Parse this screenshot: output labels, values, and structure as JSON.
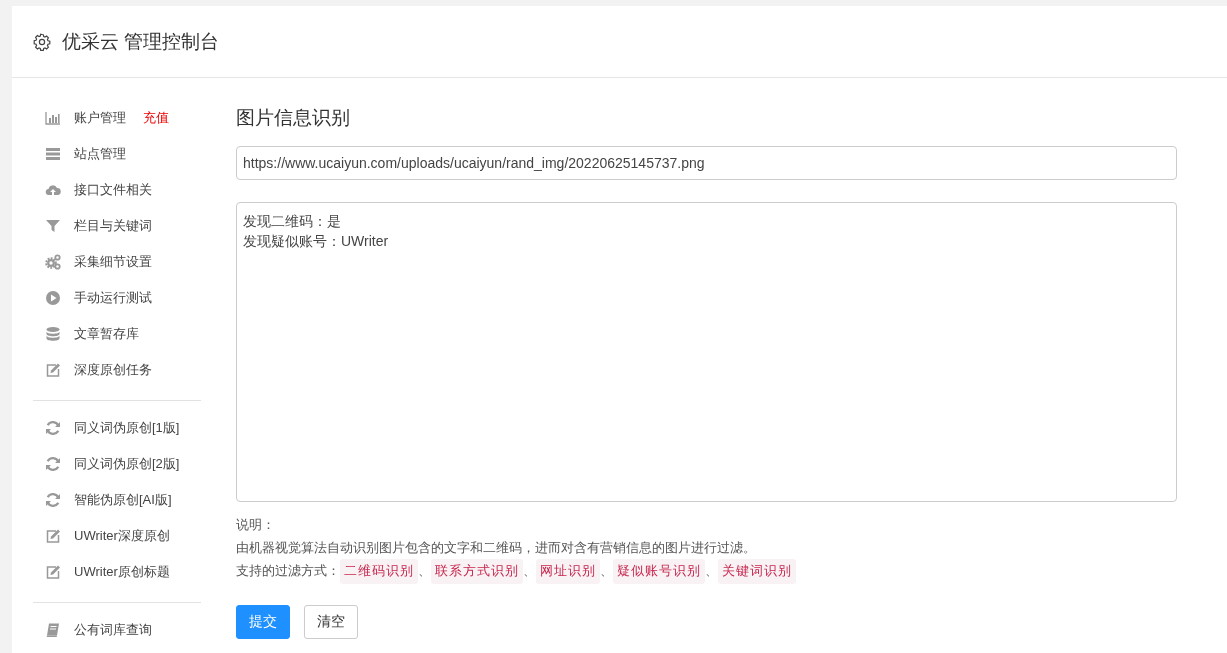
{
  "header": {
    "title": "优采云 管理控制台"
  },
  "sidebar": {
    "groups": [
      [
        {
          "label": "账户管理",
          "badge": "充值"
        },
        {
          "label": "站点管理"
        },
        {
          "label": "接口文件相关"
        },
        {
          "label": "栏目与关键词"
        },
        {
          "label": "采集细节设置"
        },
        {
          "label": "手动运行测试"
        },
        {
          "label": "文章暂存库"
        },
        {
          "label": "深度原创任务"
        }
      ],
      [
        {
          "label": "同义词伪原创[1版]"
        },
        {
          "label": "同义词伪原创[2版]"
        },
        {
          "label": "智能伪原创[AI版]"
        },
        {
          "label": "UWriter深度原创"
        },
        {
          "label": "UWriter原创标题"
        }
      ],
      [
        {
          "label": "公有词库查询"
        }
      ]
    ]
  },
  "main": {
    "title": "图片信息识别",
    "url_field": {
      "value": "https://www.ucaiyun.com/uploads/ucaiyun/rand_img/20220625145737.png"
    },
    "result_area": {
      "lines": [
        "发现二维码：是",
        "发现疑似账号：UWriter"
      ]
    },
    "notes": {
      "heading": "说明：",
      "description": "由机器视觉算法自动识别图片包含的文字和二维码，进而对含有营销信息的图片进行过滤。",
      "filters_label": "支持的过滤方式：",
      "separator": "、",
      "filters": [
        "二维码识别",
        "联系方式识别",
        "网址识别",
        "疑似账号识别",
        "关键词识别"
      ]
    },
    "buttons": [
      {
        "kind": "primary",
        "label": "提交"
      },
      {
        "kind": "default",
        "label": "清空"
      }
    ]
  }
}
